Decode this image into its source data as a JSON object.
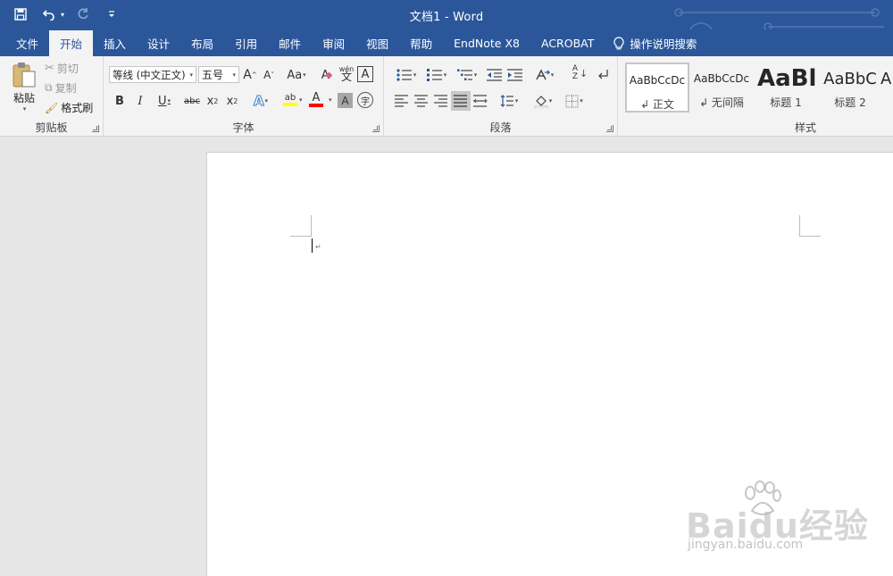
{
  "window": {
    "title": "文档1  -  Word"
  },
  "qat": {
    "save": "save-icon",
    "undo": "undo-icon",
    "redo": "redo-icon",
    "customize": "▾"
  },
  "tabs": [
    {
      "label": "文件"
    },
    {
      "label": "开始"
    },
    {
      "label": "插入"
    },
    {
      "label": "设计"
    },
    {
      "label": "布局"
    },
    {
      "label": "引用"
    },
    {
      "label": "邮件"
    },
    {
      "label": "审阅"
    },
    {
      "label": "视图"
    },
    {
      "label": "帮助"
    },
    {
      "label": "EndNote X8"
    },
    {
      "label": "ACROBAT"
    }
  ],
  "tell_me": "操作说明搜索",
  "clipboard": {
    "paste": "粘贴",
    "cut": "剪切",
    "copy": "复制",
    "format_painter": "格式刷",
    "group_label": "剪贴板"
  },
  "font": {
    "family": "等线 (中文正文)",
    "size": "五号",
    "grow": "A",
    "shrink": "A",
    "change_case": "Aa",
    "clear": "A",
    "phonetic": "文",
    "phonetic_top": "wén",
    "border_char": "A",
    "bold": "B",
    "italic": "I",
    "underline": "U",
    "strike": "abc",
    "sub": "x",
    "sub_small": "2",
    "sup": "x",
    "sup_small": "2",
    "effects": "A",
    "highlight": "ab",
    "font_color": "A",
    "shading": "A",
    "enclose": "字",
    "group_label": "字体"
  },
  "paragraph": {
    "sort": "A",
    "sort_bottom": "Z",
    "group_label": "段落"
  },
  "styles": {
    "items": [
      {
        "preview": "AaBbCcDc",
        "name": "↲ 正文"
      },
      {
        "preview": "AaBbCcDc",
        "name": "↲ 无间隔"
      },
      {
        "preview": "AaBl",
        "name": "标题 1"
      },
      {
        "preview": "AaBbC",
        "name": "标题 2"
      },
      {
        "preview": "A",
        "name": ""
      }
    ],
    "group_label": "样式"
  },
  "document": {
    "paragraph_mark": "↵"
  },
  "watermark": {
    "text": "Baidu经验",
    "url": "jingyan.baidu.com"
  },
  "colors": {
    "brand": "#2b579a",
    "highlight": "#ffff00",
    "font_color": "#ff0000"
  }
}
